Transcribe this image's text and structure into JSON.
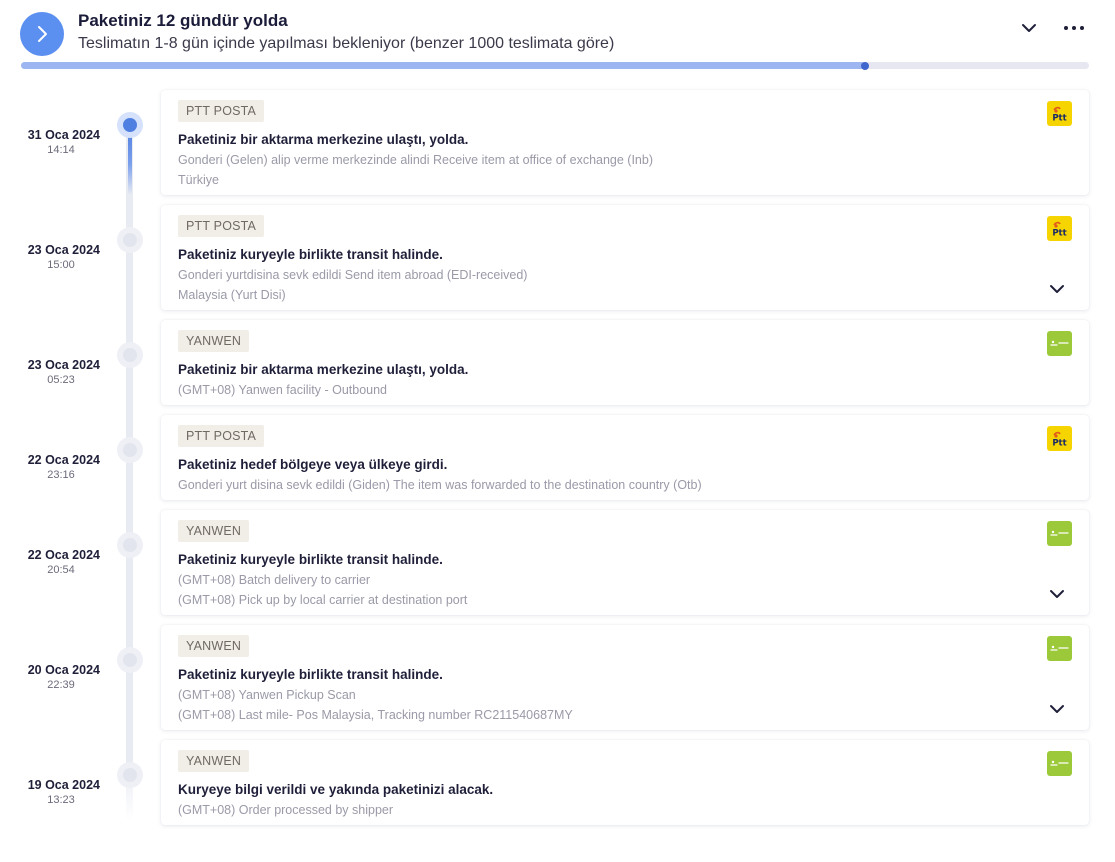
{
  "header": {
    "title": "Paketiniz 12 gündür yolda",
    "subtitle": "Teslimatın 1-8 gün içinde yapılması bekleniyor (benzer 1000 teslimata göre)",
    "progress": 0.79,
    "icons": {
      "status": "chevron-right-icon",
      "collapse": "chevron-down-icon",
      "more": "more-horizontal-icon"
    },
    "colors": {
      "accent": "#5b8ff0",
      "progress_fill": "#9db6f2",
      "progress_track": "#e6e7f1"
    }
  },
  "events": [
    {
      "date": "31 Oca 2024",
      "time": "14:14",
      "carrier": "PTT POSTA",
      "logo": "ptt",
      "active": true,
      "title": "Paketiniz bir aktarma merkezine ulaştı, yolda.",
      "lines": [
        "Gonderi (Gelen) alip verme merkezinde alindi Receive item at office of exchange (Inb)",
        "Türkiye"
      ],
      "expandable": false
    },
    {
      "date": "23 Oca 2024",
      "time": "15:00",
      "carrier": "PTT POSTA",
      "logo": "ptt",
      "active": false,
      "title": "Paketiniz kuryeyle birlikte transit halinde.",
      "lines": [
        "Gonderi yurtdisina sevk edildi Send item abroad (EDI-received)",
        "Malaysia (Yurt Disi)"
      ],
      "expandable": true
    },
    {
      "date": "23 Oca 2024",
      "time": "05:23",
      "carrier": "YANWEN",
      "logo": "yanwen",
      "active": false,
      "title": "Paketiniz bir aktarma merkezine ulaştı, yolda.",
      "lines": [
        "(GMT+08) Yanwen facility - Outbound"
      ],
      "expandable": false
    },
    {
      "date": "22 Oca 2024",
      "time": "23:16",
      "carrier": "PTT POSTA",
      "logo": "ptt",
      "active": false,
      "title": "Paketiniz hedef bölgeye veya ülkeye girdi.",
      "lines": [
        "Gonderi yurt disina sevk edildi (Giden) The item was forwarded to the destination country (Otb)"
      ],
      "expandable": false
    },
    {
      "date": "22 Oca 2024",
      "time": "20:54",
      "carrier": "YANWEN",
      "logo": "yanwen",
      "active": false,
      "title": "Paketiniz kuryeyle birlikte transit halinde.",
      "lines": [
        "(GMT+08) Batch delivery to carrier",
        "(GMT+08) Pick up by local carrier at destination port"
      ],
      "expandable": true
    },
    {
      "date": "20 Oca 2024",
      "time": "22:39",
      "carrier": "YANWEN",
      "logo": "yanwen",
      "active": false,
      "title": "Paketiniz kuryeyle birlikte transit halinde.",
      "lines": [
        "(GMT+08) Yanwen Pickup Scan",
        "(GMT+08) Last mile- Pos Malaysia, Tracking number RC211540687MY"
      ],
      "expandable": true
    },
    {
      "date": "19 Oca 2024",
      "time": "13:23",
      "carrier": "YANWEN",
      "logo": "yanwen",
      "active": false,
      "title": "Kuryeye bilgi verildi ve yakında paketinizi alacak.",
      "lines": [
        "(GMT+08) Order processed by shipper"
      ],
      "expandable": false
    }
  ]
}
